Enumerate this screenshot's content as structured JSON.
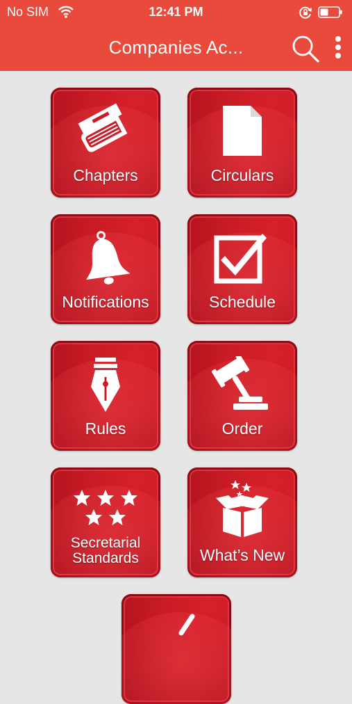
{
  "status_bar": {
    "carrier": "No SIM",
    "time": "12:41 PM",
    "wifi_icon": "wifi-icon",
    "lock_icon": "orientation-lock-icon",
    "battery_icon": "battery-icon"
  },
  "app_bar": {
    "title": "Companies Ac...",
    "search_icon": "search-icon",
    "menu_icon": "more-vert-icon"
  },
  "tiles": [
    {
      "label": "Chapters",
      "icon": "book-icon"
    },
    {
      "label": "Circulars",
      "icon": "document-icon"
    },
    {
      "label": "Notifications",
      "icon": "bell-icon"
    },
    {
      "label": "Schedule",
      "icon": "checkbox-icon"
    },
    {
      "label": "Rules",
      "icon": "fountain-pen-icon"
    },
    {
      "label": "Order",
      "icon": "gavel-icon"
    },
    {
      "label_line1": "Secretarial",
      "label_line2": "Standards",
      "icon": "stars-icon"
    },
    {
      "label": "What’s New",
      "icon": "gift-box-icon"
    },
    {
      "label": "",
      "icon": "check-icon"
    }
  ],
  "colors": {
    "accent": "#ea4a3c",
    "tile": "#c81b25",
    "background": "#e6e6e6"
  }
}
